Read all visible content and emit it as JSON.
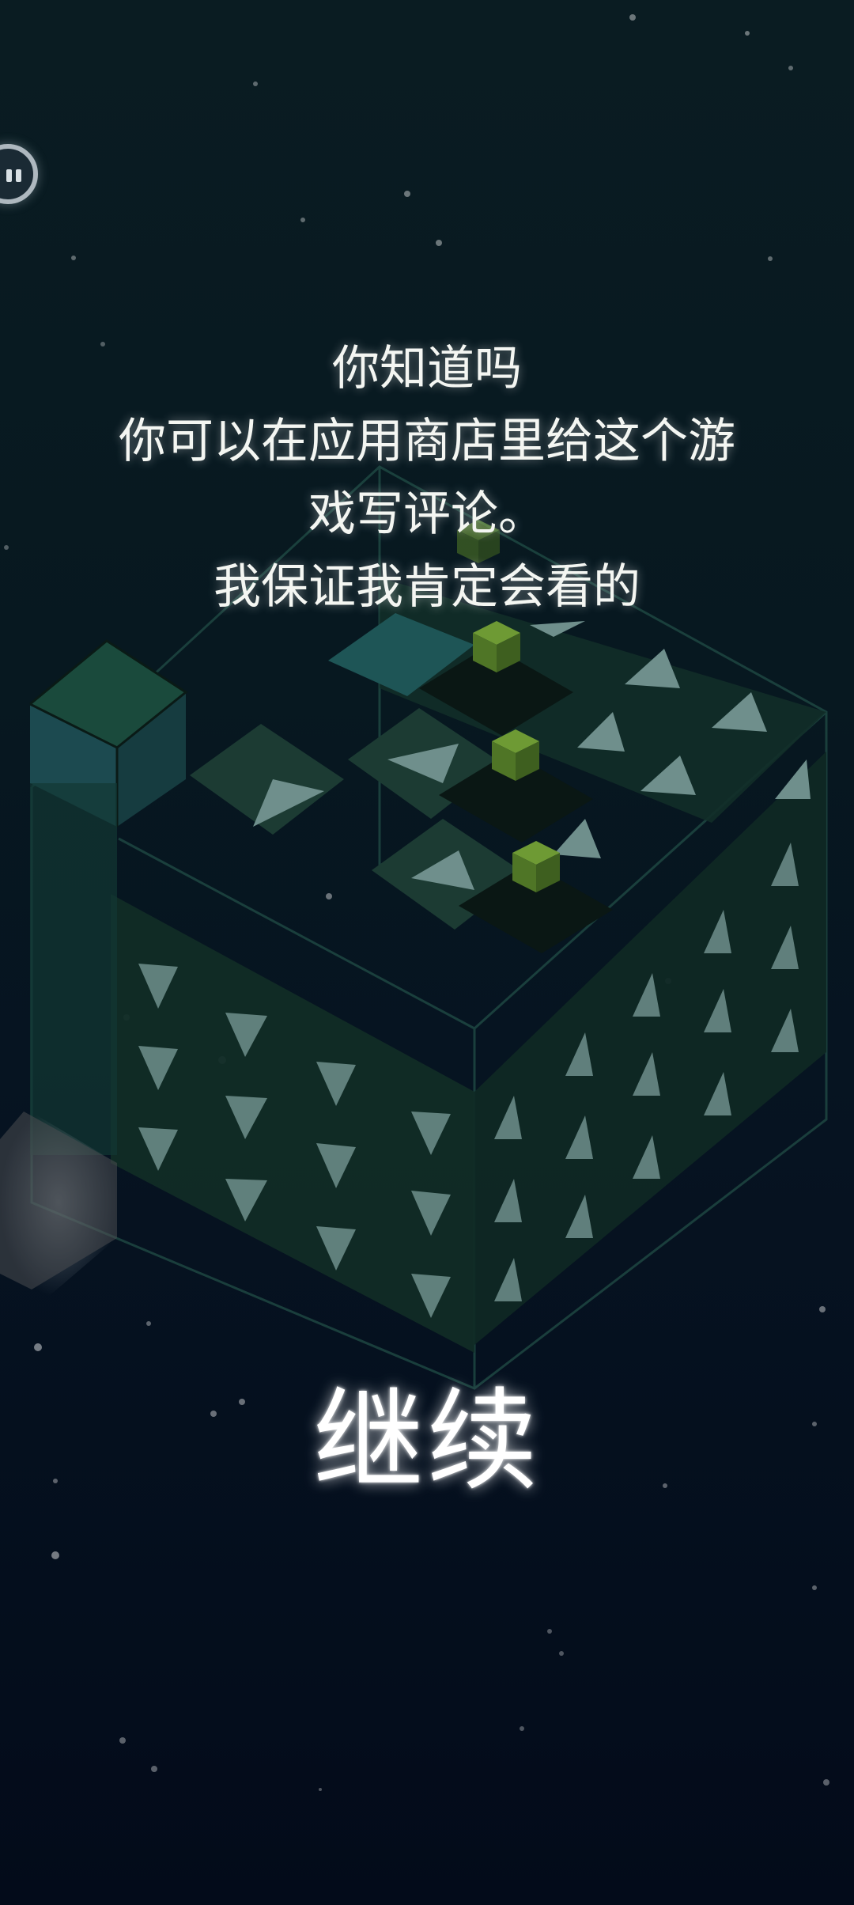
{
  "tip": {
    "line1": "你知道吗",
    "line2": "你可以在应用商店里给这个游",
    "line3": "戏写评论。",
    "line4": "我保证我肯定会看的"
  },
  "continue_label": "继续",
  "icons": {
    "pause": "pause-icon"
  },
  "colors": {
    "background_top": "#0a1c22",
    "background_bottom": "#030b1a",
    "cube_face": "#0f2b2a",
    "arrow_tile": "#6f8f8c",
    "player_cube": "#5f8f2a",
    "text": "#f4f6f2"
  }
}
